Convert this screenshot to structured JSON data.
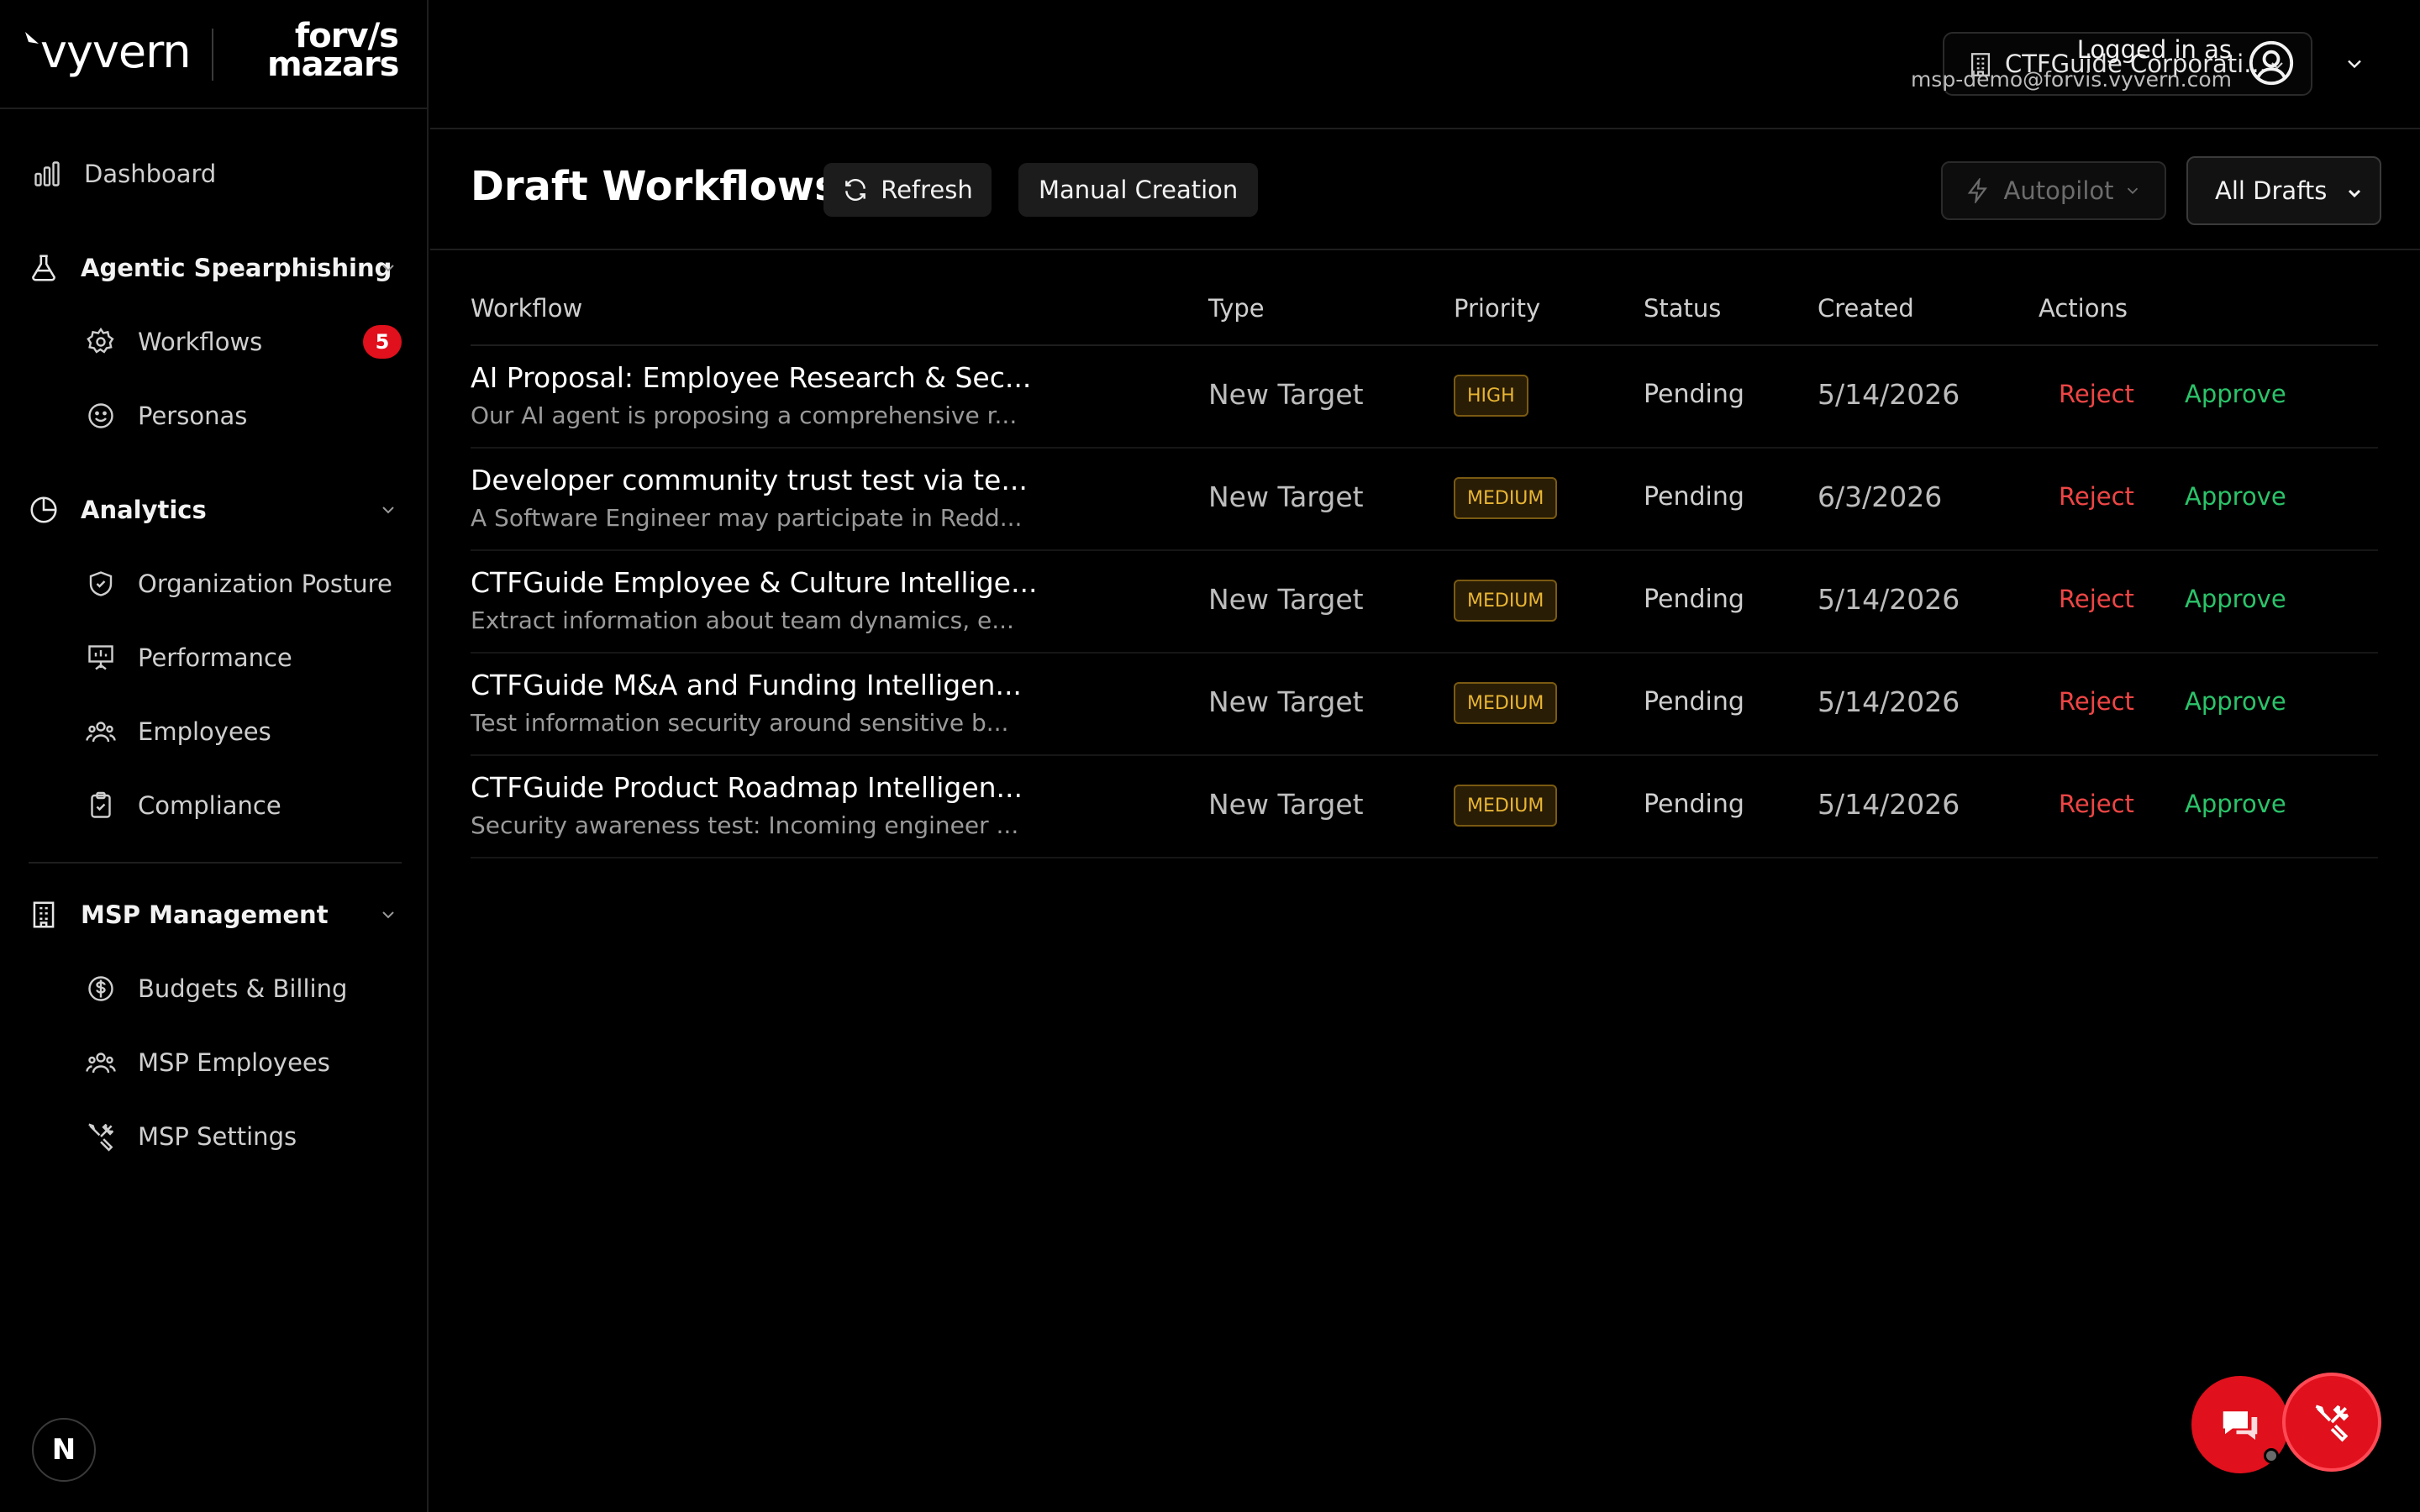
{
  "brand": {
    "vyvern": "vyvern",
    "forvis_line1": "forv/s",
    "forvis_line2": "mazars"
  },
  "sidebar": {
    "dashboard": "Dashboard",
    "sections": [
      {
        "label": "Agentic Spearphishing",
        "items": [
          {
            "label": "Workflows",
            "badge": "5"
          },
          {
            "label": "Personas"
          }
        ]
      },
      {
        "label": "Analytics",
        "items": [
          {
            "label": "Organization Posture"
          },
          {
            "label": "Performance"
          },
          {
            "label": "Employees"
          },
          {
            "label": "Compliance"
          }
        ]
      },
      {
        "label": "MSP Management",
        "items": [
          {
            "label": "Budgets & Billing"
          },
          {
            "label": "MSP Employees"
          },
          {
            "label": "MSP Settings"
          }
        ]
      }
    ],
    "avatar_letter": "N"
  },
  "topbar": {
    "org": "CTFGuide Corporati...",
    "logged_in_label": "Logged in as",
    "email": "msp-demo@forvis.vyvern.com"
  },
  "page": {
    "title": "Draft Workflows",
    "refresh": "Refresh",
    "manual": "Manual Creation",
    "autopilot": "Autopilot",
    "filter": "All Drafts"
  },
  "table": {
    "headers": {
      "workflow": "Workflow",
      "type": "Type",
      "priority": "Priority",
      "status": "Status",
      "created": "Created",
      "actions": "Actions"
    },
    "reject": "Reject",
    "approve": "Approve",
    "rows": [
      {
        "title": "AI Proposal: Employee Research & Sec...",
        "desc": "Our AI agent is proposing a comprehensive r...",
        "type": "New Target",
        "priority": "HIGH",
        "status": "Pending",
        "created": "5/14/2026"
      },
      {
        "title": "Developer community trust test via te...",
        "desc": "A Software Engineer may participate in Redd...",
        "type": "New Target",
        "priority": "MEDIUM",
        "status": "Pending",
        "created": "6/3/2026"
      },
      {
        "title": "CTFGuide Employee & Culture Intellige...",
        "desc": "Extract information about team dynamics, e...",
        "type": "New Target",
        "priority": "MEDIUM",
        "status": "Pending",
        "created": "5/14/2026"
      },
      {
        "title": "CTFGuide M&A and Funding Intelligen...",
        "desc": "Test information security around sensitive b...",
        "type": "New Target",
        "priority": "MEDIUM",
        "status": "Pending",
        "created": "5/14/2026"
      },
      {
        "title": "CTFGuide Product Roadmap Intelligen...",
        "desc": "Security awareness test: Incoming engineer ...",
        "type": "New Target",
        "priority": "MEDIUM",
        "status": "Pending",
        "created": "5/14/2026"
      }
    ]
  },
  "colors": {
    "accent_red": "#e0101c",
    "reject": "#f04545",
    "approve": "#2bc46a",
    "priority": "#e8b533"
  }
}
